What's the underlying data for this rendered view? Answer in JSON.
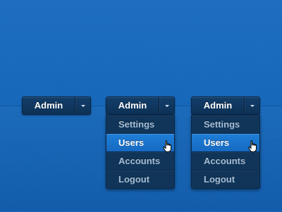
{
  "dropdowns": [
    {
      "label": "Admin",
      "open": false
    },
    {
      "label": "Admin",
      "open": true
    },
    {
      "label": "Admin",
      "open": true
    }
  ],
  "menu_items": [
    "Settings",
    "Users",
    "Accounts",
    "Logout"
  ],
  "active_item": "Users",
  "icons": {
    "toggle": "chevron-down-icon",
    "pointer": "hand-cursor-icon"
  },
  "colors": {
    "background": "#1566b9",
    "control": "#0f3459",
    "active": "#1c76cf"
  }
}
